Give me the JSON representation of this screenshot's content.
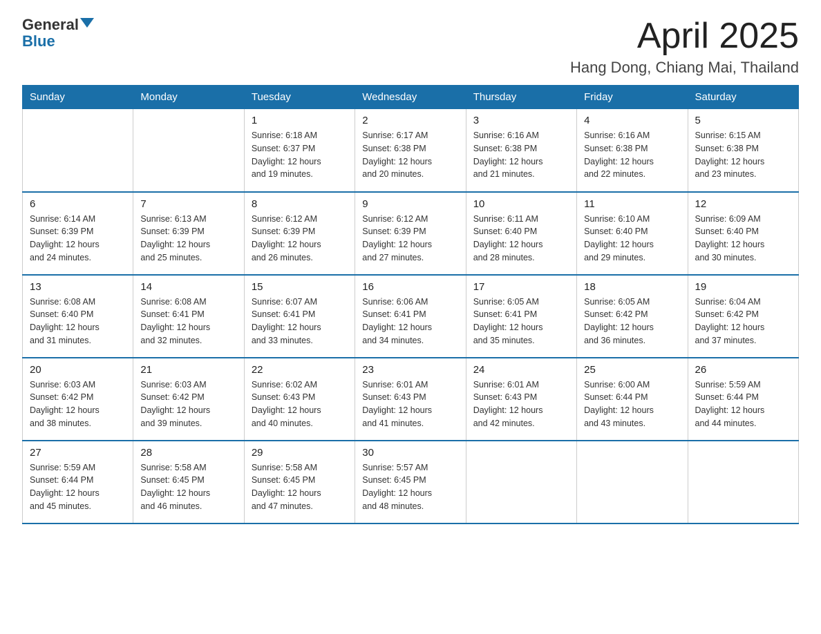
{
  "logo": {
    "general": "General",
    "blue": "Blue"
  },
  "header": {
    "month": "April 2025",
    "location": "Hang Dong, Chiang Mai, Thailand"
  },
  "weekdays": [
    "Sunday",
    "Monday",
    "Tuesday",
    "Wednesday",
    "Thursday",
    "Friday",
    "Saturday"
  ],
  "weeks": [
    [
      {
        "day": "",
        "info": ""
      },
      {
        "day": "",
        "info": ""
      },
      {
        "day": "1",
        "info": "Sunrise: 6:18 AM\nSunset: 6:37 PM\nDaylight: 12 hours\nand 19 minutes."
      },
      {
        "day": "2",
        "info": "Sunrise: 6:17 AM\nSunset: 6:38 PM\nDaylight: 12 hours\nand 20 minutes."
      },
      {
        "day": "3",
        "info": "Sunrise: 6:16 AM\nSunset: 6:38 PM\nDaylight: 12 hours\nand 21 minutes."
      },
      {
        "day": "4",
        "info": "Sunrise: 6:16 AM\nSunset: 6:38 PM\nDaylight: 12 hours\nand 22 minutes."
      },
      {
        "day": "5",
        "info": "Sunrise: 6:15 AM\nSunset: 6:38 PM\nDaylight: 12 hours\nand 23 minutes."
      }
    ],
    [
      {
        "day": "6",
        "info": "Sunrise: 6:14 AM\nSunset: 6:39 PM\nDaylight: 12 hours\nand 24 minutes."
      },
      {
        "day": "7",
        "info": "Sunrise: 6:13 AM\nSunset: 6:39 PM\nDaylight: 12 hours\nand 25 minutes."
      },
      {
        "day": "8",
        "info": "Sunrise: 6:12 AM\nSunset: 6:39 PM\nDaylight: 12 hours\nand 26 minutes."
      },
      {
        "day": "9",
        "info": "Sunrise: 6:12 AM\nSunset: 6:39 PM\nDaylight: 12 hours\nand 27 minutes."
      },
      {
        "day": "10",
        "info": "Sunrise: 6:11 AM\nSunset: 6:40 PM\nDaylight: 12 hours\nand 28 minutes."
      },
      {
        "day": "11",
        "info": "Sunrise: 6:10 AM\nSunset: 6:40 PM\nDaylight: 12 hours\nand 29 minutes."
      },
      {
        "day": "12",
        "info": "Sunrise: 6:09 AM\nSunset: 6:40 PM\nDaylight: 12 hours\nand 30 minutes."
      }
    ],
    [
      {
        "day": "13",
        "info": "Sunrise: 6:08 AM\nSunset: 6:40 PM\nDaylight: 12 hours\nand 31 minutes."
      },
      {
        "day": "14",
        "info": "Sunrise: 6:08 AM\nSunset: 6:41 PM\nDaylight: 12 hours\nand 32 minutes."
      },
      {
        "day": "15",
        "info": "Sunrise: 6:07 AM\nSunset: 6:41 PM\nDaylight: 12 hours\nand 33 minutes."
      },
      {
        "day": "16",
        "info": "Sunrise: 6:06 AM\nSunset: 6:41 PM\nDaylight: 12 hours\nand 34 minutes."
      },
      {
        "day": "17",
        "info": "Sunrise: 6:05 AM\nSunset: 6:41 PM\nDaylight: 12 hours\nand 35 minutes."
      },
      {
        "day": "18",
        "info": "Sunrise: 6:05 AM\nSunset: 6:42 PM\nDaylight: 12 hours\nand 36 minutes."
      },
      {
        "day": "19",
        "info": "Sunrise: 6:04 AM\nSunset: 6:42 PM\nDaylight: 12 hours\nand 37 minutes."
      }
    ],
    [
      {
        "day": "20",
        "info": "Sunrise: 6:03 AM\nSunset: 6:42 PM\nDaylight: 12 hours\nand 38 minutes."
      },
      {
        "day": "21",
        "info": "Sunrise: 6:03 AM\nSunset: 6:42 PM\nDaylight: 12 hours\nand 39 minutes."
      },
      {
        "day": "22",
        "info": "Sunrise: 6:02 AM\nSunset: 6:43 PM\nDaylight: 12 hours\nand 40 minutes."
      },
      {
        "day": "23",
        "info": "Sunrise: 6:01 AM\nSunset: 6:43 PM\nDaylight: 12 hours\nand 41 minutes."
      },
      {
        "day": "24",
        "info": "Sunrise: 6:01 AM\nSunset: 6:43 PM\nDaylight: 12 hours\nand 42 minutes."
      },
      {
        "day": "25",
        "info": "Sunrise: 6:00 AM\nSunset: 6:44 PM\nDaylight: 12 hours\nand 43 minutes."
      },
      {
        "day": "26",
        "info": "Sunrise: 5:59 AM\nSunset: 6:44 PM\nDaylight: 12 hours\nand 44 minutes."
      }
    ],
    [
      {
        "day": "27",
        "info": "Sunrise: 5:59 AM\nSunset: 6:44 PM\nDaylight: 12 hours\nand 45 minutes."
      },
      {
        "day": "28",
        "info": "Sunrise: 5:58 AM\nSunset: 6:45 PM\nDaylight: 12 hours\nand 46 minutes."
      },
      {
        "day": "29",
        "info": "Sunrise: 5:58 AM\nSunset: 6:45 PM\nDaylight: 12 hours\nand 47 minutes."
      },
      {
        "day": "30",
        "info": "Sunrise: 5:57 AM\nSunset: 6:45 PM\nDaylight: 12 hours\nand 48 minutes."
      },
      {
        "day": "",
        "info": ""
      },
      {
        "day": "",
        "info": ""
      },
      {
        "day": "",
        "info": ""
      }
    ]
  ]
}
